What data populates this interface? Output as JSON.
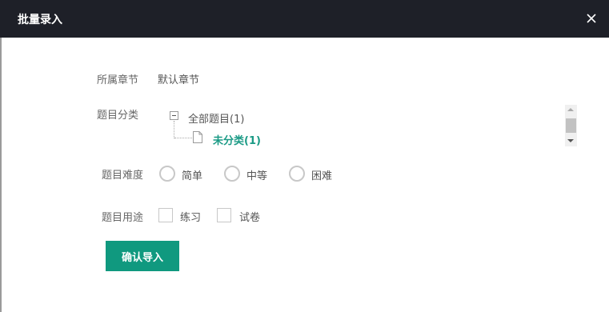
{
  "dialog": {
    "title": "批量录入",
    "close_icon": "close-icon"
  },
  "chapter": {
    "label": "所属章节",
    "value": "默认章节"
  },
  "category": {
    "label": "题目分类",
    "root": "全部题目(1)",
    "child": "未分类(1)"
  },
  "difficulty": {
    "label": "题目难度",
    "options": [
      "简单",
      "中等",
      "困难"
    ]
  },
  "usage": {
    "label": "题目用途",
    "options": [
      "练习",
      "试卷"
    ]
  },
  "confirm_label": "确认导入",
  "colors": {
    "header_bg": "#1e2028",
    "accent": "#10997f",
    "tree_selected": "#1a9a85"
  }
}
